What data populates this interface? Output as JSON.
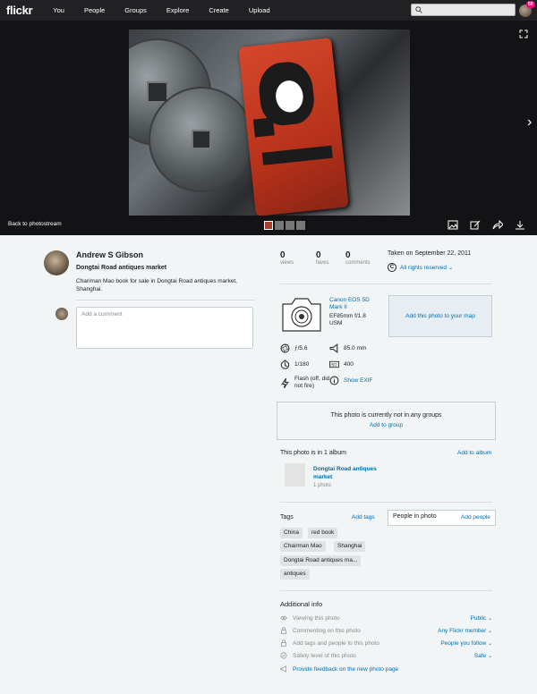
{
  "nav": {
    "logo": "flickr",
    "links": [
      "You",
      "People",
      "Groups",
      "Explore",
      "Create",
      "Upload"
    ],
    "notification_count": "50"
  },
  "stage": {
    "back_label": "Back to photostream"
  },
  "owner": {
    "name": "Andrew S Gibson"
  },
  "photo": {
    "title": "Dongtai Road antiques market",
    "description": "Chariman Mao book for sale in Dongtai Road antiques market, Shanghai."
  },
  "comment": {
    "placeholder": "Add a comment"
  },
  "stats": [
    {
      "value": "0",
      "label": "views"
    },
    {
      "value": "0",
      "label": "faves"
    },
    {
      "value": "0",
      "label": "comments"
    }
  ],
  "taken": "Taken on September 22, 2011",
  "rights": {
    "symbol": "C",
    "label": "All rights reserved"
  },
  "camera": {
    "name": "Canon EOS 5D Mark II",
    "lens": "EF85mm f/1.8 USM"
  },
  "map_label": "Add this photo to your map",
  "exif": {
    "aperture": "ƒ/5.6",
    "focal": "85.0 mm",
    "shutter": "1/180",
    "iso": "400",
    "flash": "Flash (off, did not fire)",
    "show_exif": "Show EXIF"
  },
  "groups": {
    "text": "This photo is currently not in any groups",
    "add": "Add to group"
  },
  "album": {
    "title": "This photo is in 1 album",
    "add": "Add to album",
    "name": "Dongtai Road antiques market",
    "count": "1 photo"
  },
  "tags": {
    "label": "Tags",
    "add": "Add tags",
    "items": [
      "China",
      "red book",
      "Chairman Mao",
      "Shanghai",
      "Dongtai Road antiques ma...",
      "antiques"
    ]
  },
  "people": {
    "label": "People in photo",
    "add": "Add people"
  },
  "additional": {
    "title": "Additional info",
    "rows": [
      {
        "label": "Viewing this photo",
        "value": "Public"
      },
      {
        "label": "Commenting on this photo",
        "value": "Any Flickr member"
      },
      {
        "label": "Add tags and people to this photo",
        "value": "People you follow"
      },
      {
        "label": "Safety level of this photo",
        "value": "Safe"
      }
    ],
    "feedback": "Provide feedback on the new photo page"
  },
  "colors": {
    "nav_bg": "#212124",
    "stage_bg": "#131315",
    "link": "#006dac",
    "badge": "#ff0084"
  }
}
